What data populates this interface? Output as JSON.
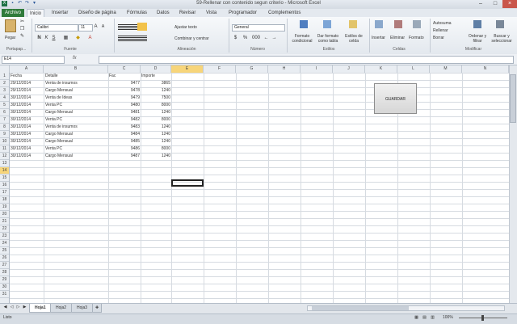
{
  "window": {
    "title": "59-Rellenar con contenido segun criterio - Microsoft Excel",
    "controls": [
      "–",
      "□",
      "×"
    ]
  },
  "ribbon_tabs": [
    "Archivo",
    "Inicio",
    "Insertar",
    "Diseño de página",
    "Fórmulas",
    "Datos",
    "Revisar",
    "Vista",
    "Programador",
    "Complementos"
  ],
  "ribbon": {
    "clipboard": {
      "paste": "Pegar",
      "label": "Portapap..."
    },
    "font": {
      "name": "Calibri",
      "size": "11",
      "label": "Fuente",
      "bold": "N",
      "italic": "K",
      "underline": "S"
    },
    "alignment": {
      "wrap": "Ajustar texto",
      "merge": "Combinar y centrar",
      "label": "Alineación"
    },
    "number": {
      "format": "General",
      "label": "Número",
      "currency": "$",
      "percent": "%",
      "thousands": "000"
    },
    "styles": {
      "conditional": "Formato condicional",
      "table": "Dar formato como tabla",
      "cell": "Estilos de celda",
      "label": "Estilos"
    },
    "cells": {
      "insert": "Insertar",
      "delete": "Eliminar",
      "format": "Formato",
      "label": "Celdas"
    },
    "editing": {
      "autosum": "Autosuma",
      "fill": "Rellenar",
      "clear": "Borrar",
      "sort": "Ordenar y filtrar",
      "find": "Buscar y seleccionar",
      "label": "Modificar"
    }
  },
  "formula_bar": {
    "name_box": "E14",
    "fx": "fx",
    "value": ""
  },
  "columns": [
    "A",
    "B",
    "C",
    "D",
    "E",
    "F",
    "G",
    "H",
    "I",
    "J",
    "K",
    "L",
    "M",
    "N"
  ],
  "rows": [
    "1",
    "2",
    "3",
    "4",
    "5",
    "6",
    "7",
    "8",
    "9",
    "10",
    "11",
    "12",
    "13",
    "14",
    "15",
    "16",
    "17",
    "18",
    "19",
    "20",
    "21",
    "22",
    "23",
    "24",
    "25",
    "26",
    "27",
    "28",
    "29",
    "30",
    "31"
  ],
  "table": {
    "headers": [
      "Fecha",
      "Detalle",
      "Fac",
      "Importe"
    ],
    "rows": [
      [
        "29/12/2014",
        "Venta de insumos",
        "9477",
        "3865"
      ],
      [
        "29/12/2014",
        "Cargo Mensual",
        "9478",
        "1240"
      ],
      [
        "30/12/2014",
        "Venta de Ideas",
        "9479",
        "7500"
      ],
      [
        "30/12/2014",
        "Venta PC",
        "9480",
        "8000"
      ],
      [
        "30/12/2014",
        "Cargo Mensual",
        "9481",
        "1240"
      ],
      [
        "30/12/2014",
        "Venta PC",
        "9482",
        "8000"
      ],
      [
        "30/12/2014",
        "Venta de insumos",
        "9483",
        "1240"
      ],
      [
        "30/12/2014",
        "Cargo Mensual",
        "9484",
        "1240"
      ],
      [
        "30/12/2014",
        "Cargo Mensual",
        "9485",
        "1240"
      ],
      [
        "30/12/2014",
        "Venta PC",
        "9486",
        "8000"
      ],
      [
        "30/12/2014",
        "Cargo Mensual",
        "9487",
        "1240"
      ]
    ]
  },
  "button_label": "GUARDAR",
  "sheets": [
    "Hoja1",
    "Hoja2",
    "Hoja3"
  ],
  "status": {
    "left": "Listo",
    "zoom": "100%"
  },
  "colors": {
    "file_tab": "#2f7b3b",
    "selection": "#f7d57a"
  }
}
